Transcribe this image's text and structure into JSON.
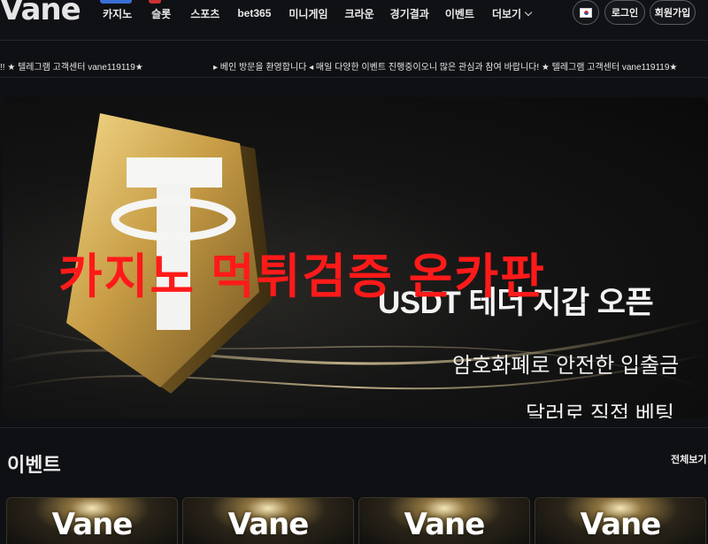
{
  "header": {
    "logo": "Vane",
    "nav": [
      "카지노",
      "슬롯",
      "스포츠",
      "bet365",
      "미니게임",
      "크라운",
      "경기결과",
      "이벤트",
      "더보기"
    ],
    "login_label": "로그인",
    "join_label": "회원가입",
    "flag_icon": "korea-flag-icon"
  },
  "ticker": {
    "left_text": "!! ★ 텔레그램 고객센터 vane119119★",
    "main_text": "▸ 베인 방문을 환영합니다 ◂ 매일 다양한 이벤트 진행중이오니 많은 관심과 참여 바랍니다! ★ 텔레그램 고객센터 vane119119★"
  },
  "banner": {
    "title": "USDT 테더 지갑 오픈",
    "line1": "암호화폐로 안전한 입출금",
    "line2": "달러로 직접 베팅",
    "watermark": "카지노 먹튀검증 온카판",
    "logo_letter": "T"
  },
  "events": {
    "title": "이벤트",
    "view_all": "전체보기",
    "cards": [
      "Vane",
      "Vane",
      "Vane",
      "Vane"
    ]
  },
  "colors": {
    "accent_red": "#ff1a1a",
    "gold": "#c9a44e",
    "background": "#0f1013"
  }
}
